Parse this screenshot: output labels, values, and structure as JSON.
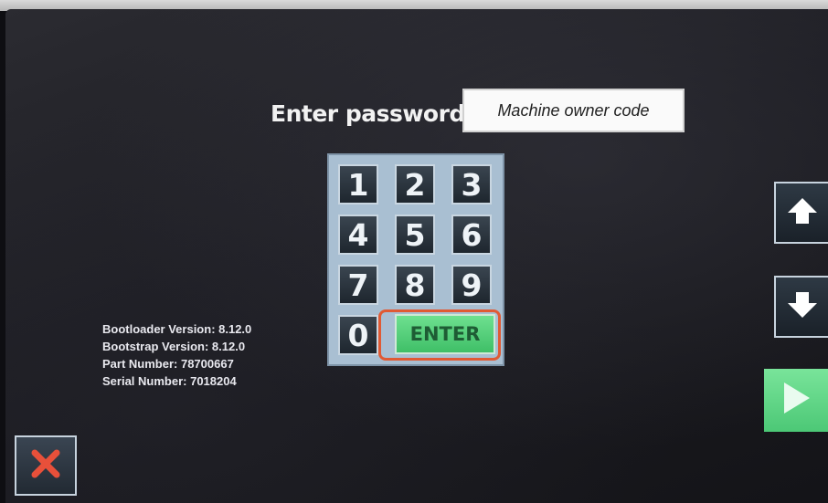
{
  "password": {
    "prompt_label": "Enter password:",
    "field_value": "Machine owner code"
  },
  "keypad": {
    "keys": [
      "1",
      "2",
      "3",
      "4",
      "5",
      "6",
      "7",
      "8",
      "9",
      "0"
    ],
    "enter_label": "ENTER"
  },
  "device_info": {
    "bootloader": "Bootloader Version: 8.12.0",
    "bootstrap": "Bootstrap Version: 8.12.0",
    "part_number": "Part Number: 78700667",
    "serial_number": "Serial Number: 7018204"
  },
  "side_buttons": {
    "up_icon": "arrow-up-icon",
    "down_icon": "arrow-down-icon",
    "next_icon": "play-icon",
    "close_icon": "close-x-icon"
  },
  "colors": {
    "keypad_background": "#a9bfd2",
    "enter_green": "#4cc876",
    "highlight_outline": "#e05a34",
    "close_red": "#e8503a"
  }
}
